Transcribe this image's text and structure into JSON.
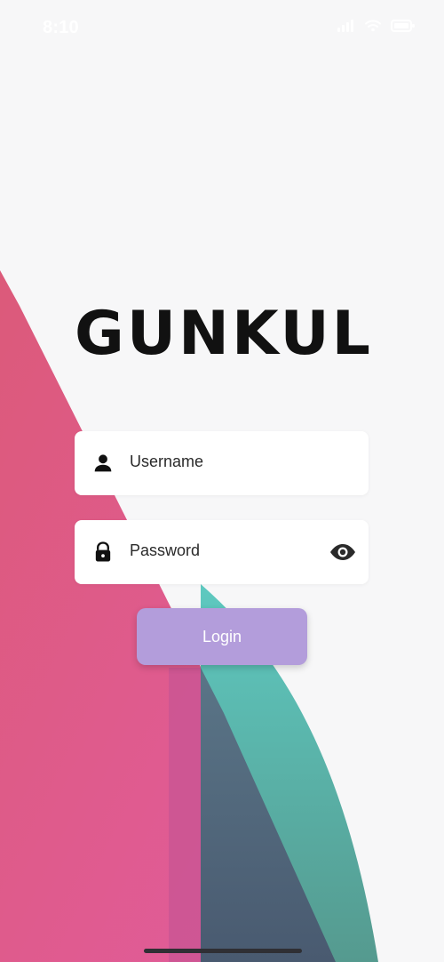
{
  "status_bar": {
    "time": "8:10",
    "icons": [
      "signal-icon",
      "wifi-icon",
      "battery-icon"
    ]
  },
  "brand": {
    "logo_text": "GUNKUL"
  },
  "login_form": {
    "username": {
      "label": "Username",
      "icon": "user-icon"
    },
    "password": {
      "label": "Password",
      "icon": "lock-icon",
      "toggle_icon": "eye-icon"
    },
    "button": {
      "label": "Login"
    }
  },
  "colors": {
    "background": "#f7f7f8",
    "shape_pink": "#e05b8b",
    "shape_magenta": "#d35aa2",
    "shape_teal": "#5ec7bb",
    "shape_slate": "#4c6278",
    "login_button": "#b39ddb",
    "field_background": "#ffffff",
    "text": "#111111"
  }
}
